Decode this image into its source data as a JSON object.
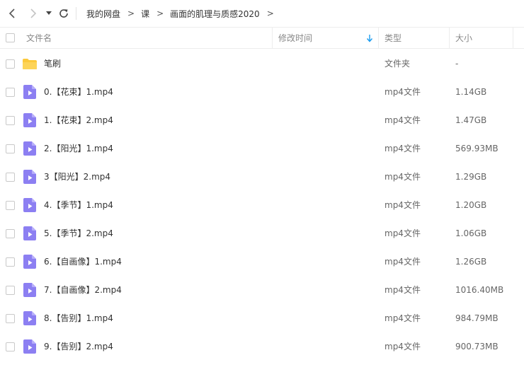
{
  "breadcrumb": {
    "items": [
      "我的网盘",
      "课",
      "画面的肌理与质感2020"
    ],
    "separator": ">"
  },
  "columns": {
    "name": "文件名",
    "modified": "修改时间",
    "type": "类型",
    "size": "大小"
  },
  "files": [
    {
      "name": "笔刷",
      "type": "文件夹",
      "size": "-",
      "icon": "folder-icon"
    },
    {
      "name": "0.【花束】1.mp4",
      "type": "mp4文件",
      "size": "1.14GB",
      "icon": "video-file-icon"
    },
    {
      "name": "1.【花束】2.mp4",
      "type": "mp4文件",
      "size": "1.47GB",
      "icon": "video-file-icon"
    },
    {
      "name": "2.【阳光】1.mp4",
      "type": "mp4文件",
      "size": "569.93MB",
      "icon": "video-file-icon"
    },
    {
      "name": "3【阳光】2.mp4",
      "type": "mp4文件",
      "size": "1.29GB",
      "icon": "video-file-icon"
    },
    {
      "name": "4.【季节】1.mp4",
      "type": "mp4文件",
      "size": "1.20GB",
      "icon": "video-file-icon"
    },
    {
      "name": "5.【季节】2.mp4",
      "type": "mp4文件",
      "size": "1.06GB",
      "icon": "video-file-icon"
    },
    {
      "name": "6.【自画像】1.mp4",
      "type": "mp4文件",
      "size": "1.26GB",
      "icon": "video-file-icon"
    },
    {
      "name": "7.【自画像】2.mp4",
      "type": "mp4文件",
      "size": "1016.40MB",
      "icon": "video-file-icon"
    },
    {
      "name": "8.【告别】1.mp4",
      "type": "mp4文件",
      "size": "984.79MB",
      "icon": "video-file-icon"
    },
    {
      "name": "9.【告别】2.mp4",
      "type": "mp4文件",
      "size": "900.73MB",
      "icon": "video-file-icon"
    }
  ],
  "colors": {
    "sort_arrow": "#1a9cf0",
    "folder": "#fcc93c",
    "video_icon": "#8c7ff2"
  },
  "icons": {
    "back": "chevron-left-icon",
    "forward": "chevron-right-icon",
    "dropdown": "caret-down-icon",
    "refresh": "refresh-icon",
    "sort": "arrow-down-icon"
  }
}
